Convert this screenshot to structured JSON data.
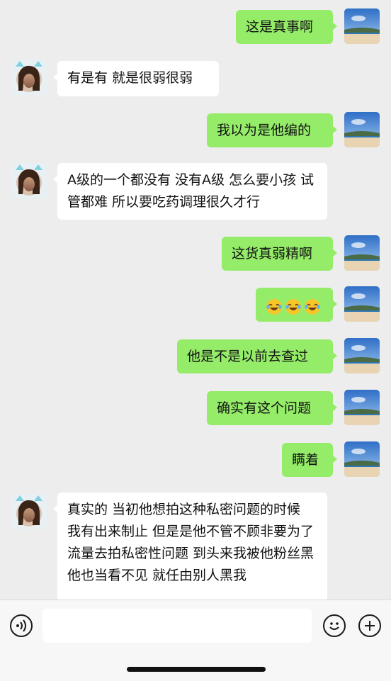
{
  "messages": [
    {
      "sender": "me",
      "text": "这是真事啊"
    },
    {
      "sender": "her",
      "text": "有是有 就是很弱很弱"
    },
    {
      "sender": "me",
      "text": "我以为是他编的"
    },
    {
      "sender": "her",
      "text": "A级的一个都没有 没有A级 怎么要小孩 试管都难 所以要吃药调理很久才行"
    },
    {
      "sender": "me",
      "text": "这货真弱精啊"
    },
    {
      "sender": "me",
      "emoji": [
        "face-with-tears-of-joy-icon",
        "face-with-tears-of-joy-icon",
        "face-with-tears-of-joy-icon"
      ]
    },
    {
      "sender": "me",
      "text": "他是不是以前去查过"
    },
    {
      "sender": "me",
      "text": "确实有这个问题"
    },
    {
      "sender": "me",
      "text": "瞒着"
    },
    {
      "sender": "her",
      "text": "真实的 当初他想拍这种私密问题的时候 我有出来制止 但是是他不管不顾非要为了流量去拍私密性问题 到头来我被他粉丝黑 他也当看不见 就任由别人黑我"
    }
  ],
  "input_bar": {
    "voice_icon": "voice-icon",
    "emoji_icon": "smiley-icon",
    "add_icon": "plus-icon",
    "input_value": ""
  },
  "colors": {
    "background": "#ededed",
    "my_bubble": "#95ec69",
    "her_bubble": "#ffffff",
    "input_bar": "#f7f7f7"
  }
}
